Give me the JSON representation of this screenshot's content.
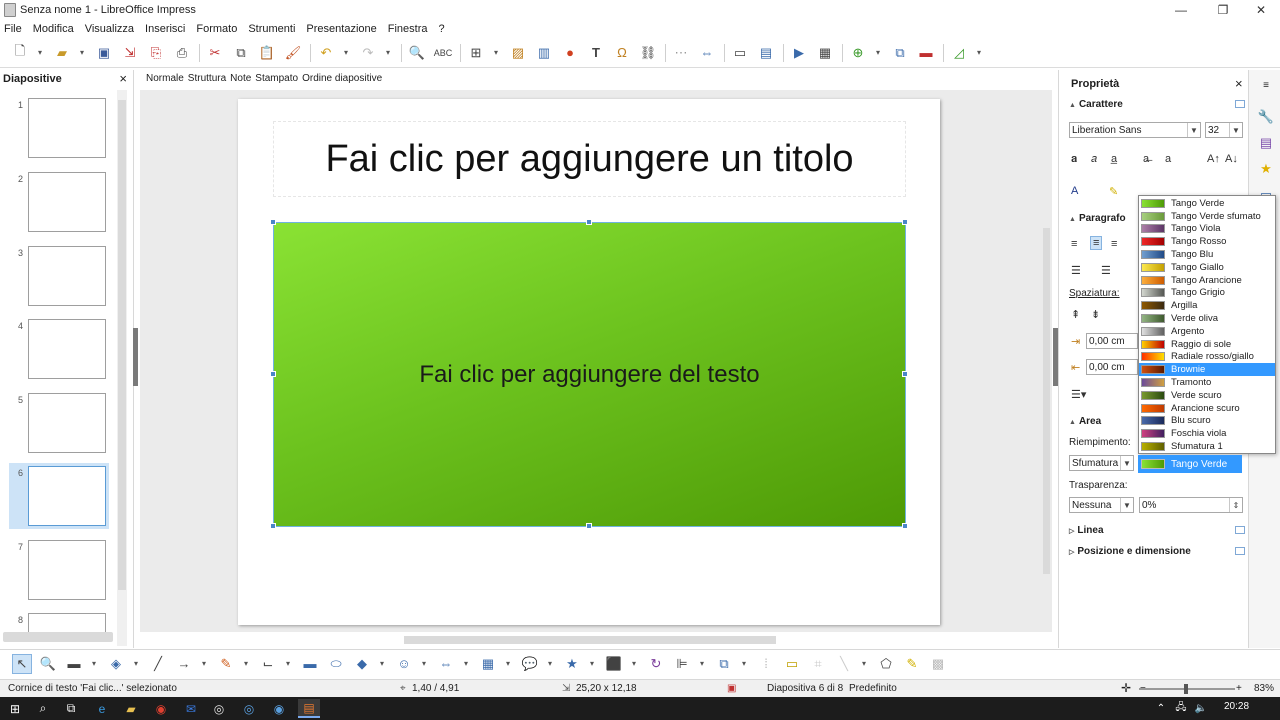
{
  "window": {
    "title": "Senza nome 1 - LibreOffice Impress",
    "minimize_icon": "minimize-icon",
    "maximize_icon": "restore-icon",
    "close_icon": "close-icon"
  },
  "menu": [
    "File",
    "Modifica",
    "Visualizza",
    "Inserisci",
    "Formato",
    "Strumenti",
    "Presentazione",
    "Finestra",
    "?"
  ],
  "slide_panel": {
    "title": "Diapositive",
    "close": "×",
    "slides": [
      {
        "num": "1"
      },
      {
        "num": "2"
      },
      {
        "num": "3"
      },
      {
        "num": "4"
      },
      {
        "num": "5"
      },
      {
        "num": "6"
      },
      {
        "num": "7"
      },
      {
        "num": "8"
      }
    ],
    "selected_slide": "6"
  },
  "view_tabs": [
    "Normale",
    "Struttura",
    "Note",
    "Stampato",
    "Ordine diapositive"
  ],
  "slide": {
    "title_placeholder": "Fai clic per aggiungere un titolo",
    "content_placeholder": "Fai clic per aggiungere del testo",
    "fill_colors": {
      "start": "#8ae234",
      "end": "#4e9a06"
    }
  },
  "properties": {
    "title": "Proprietà",
    "close": "×",
    "carattere": {
      "heading": "Carattere",
      "font_name": "Liberation Sans",
      "font_size": "32"
    },
    "paragrafo": {
      "heading": "Paragrafo",
      "spaziatura_label": "Spaziatura:",
      "indent_before": "0,00 cm",
      "indent_after": "0,00 cm"
    },
    "area": {
      "heading": "Area",
      "riempimento_label": "Riempimento:",
      "riempimento_value": "Sfumatura",
      "gradient_value": "Tango Verde",
      "trasparenza_label": "Trasparenza:",
      "trasparenza_value": "Nessuna",
      "trasparenza_percent": "0%"
    },
    "linea": {
      "heading": "Linea"
    },
    "posizione": {
      "heading": "Posizione e dimensione"
    }
  },
  "gradient_list": {
    "highlighted": "Brownie",
    "items": [
      {
        "name": "Tango Verde",
        "c1": "#8ae234",
        "c2": "#4e9a06"
      },
      {
        "name": "Tango Verde sfumato",
        "c1": "#a8d080",
        "c2": "#6a9a3a"
      },
      {
        "name": "Tango Viola",
        "c1": "#ad7fa8",
        "c2": "#5c3566"
      },
      {
        "name": "Tango Rosso",
        "c1": "#ef2929",
        "c2": "#a40000"
      },
      {
        "name": "Tango Blu",
        "c1": "#729fcf",
        "c2": "#204a87"
      },
      {
        "name": "Tango Giallo",
        "c1": "#fce94f",
        "c2": "#c4a000"
      },
      {
        "name": "Tango Arancione",
        "c1": "#fcaf3e",
        "c2": "#ce5c00"
      },
      {
        "name": "Tango Grigio",
        "c1": "#d3d7cf",
        "c2": "#555753"
      },
      {
        "name": "Argilla",
        "c1": "#8f5902",
        "c2": "#3a2a10"
      },
      {
        "name": "Verde oliva",
        "c1": "#93b583",
        "c2": "#3e5a2e"
      },
      {
        "name": "Argento",
        "c1": "#e0e0e0",
        "c2": "#606060"
      },
      {
        "name": "Raggio di sole",
        "c1": "#ffd000",
        "c2": "#c00000"
      },
      {
        "name": "Radiale rosso/giallo",
        "c1": "#ff3000",
        "c2": "#ffe000"
      },
      {
        "name": "Brownie",
        "c1": "#d05010",
        "c2": "#5a1a00"
      },
      {
        "name": "Tramonto",
        "c1": "#6a4a9a",
        "c2": "#d0a040"
      },
      {
        "name": "Verde scuro",
        "c1": "#7a9a30",
        "c2": "#2a4a10"
      },
      {
        "name": "Arancione scuro",
        "c1": "#ff6a00",
        "c2": "#c03a00"
      },
      {
        "name": "Blu scuro",
        "c1": "#4a6aaa",
        "c2": "#1a2a5a"
      },
      {
        "name": "Foschia viola",
        "c1": "#d04080",
        "c2": "#402060"
      },
      {
        "name": "Sfumatura 1",
        "c1": "#b8b000",
        "c2": "#606000"
      }
    ]
  },
  "status": {
    "selection": "Cornice di testo 'Fai clic...' selezionato",
    "position": "1,40 / 4,91",
    "size": "25,20 x 12,18",
    "slide_info": "Diapositiva 6 di 8",
    "layout": "Predefinito",
    "zoom": "83%",
    "zoom_minus": "−",
    "zoom_plus": "+"
  },
  "taskbar": {
    "clock": "20:28"
  }
}
